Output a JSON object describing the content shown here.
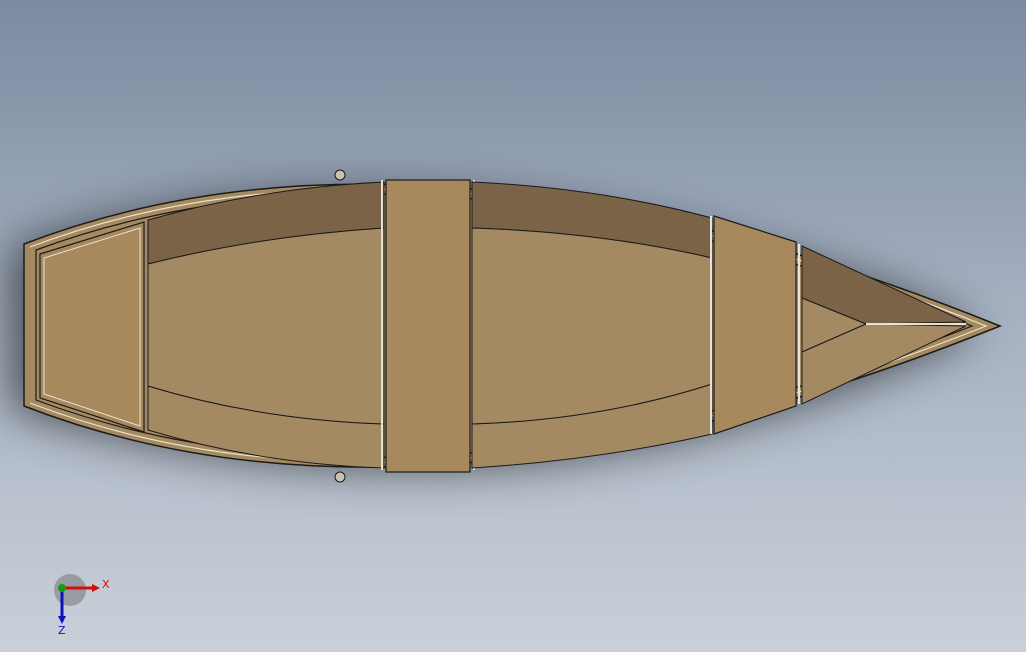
{
  "viewport": {
    "background_top": "#7c8aa0",
    "background_bottom": "#c9d0d9"
  },
  "model": {
    "name": "rowboat",
    "hull_color": "#a68a5f",
    "seat_color": "#a8895e",
    "floor_color": "#a48a63",
    "side_wall_color": "#7a6347",
    "edge_color": "#1a1a1a",
    "highlight_color": "#e8e2d4"
  },
  "triad": {
    "x_label": "X",
    "z_label": "Z",
    "x_color": "#d01010",
    "y_color": "#10a010",
    "z_color": "#1010c0"
  }
}
